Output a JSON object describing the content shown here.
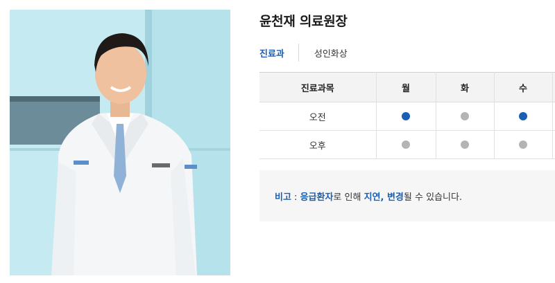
{
  "doctor": {
    "name": "윤천재 의료원장",
    "photo_alt": "의사 사진"
  },
  "department": {
    "label": "진료과",
    "value": "성인화상"
  },
  "schedule": {
    "headers": [
      "진료과목",
      "월",
      "화",
      "수",
      ""
    ],
    "rows": [
      {
        "label": "오전",
        "status": [
          "on",
          "off",
          "on",
          "off"
        ]
      },
      {
        "label": "오후",
        "status": [
          "off",
          "off",
          "off",
          "off"
        ]
      }
    ],
    "colors": {
      "on": "#1a5fb4",
      "off": "#b4b4b4"
    }
  },
  "note": {
    "label": "비고",
    "colon": " :  ",
    "emphasis1": "응급환자",
    "text1": "로 인해 ",
    "emphasis2": "지연, 변경",
    "text2": "될 수 있습니다."
  },
  "colors": {
    "accent": "#1a5fb4",
    "photo_bg": "#bfe6ee"
  }
}
